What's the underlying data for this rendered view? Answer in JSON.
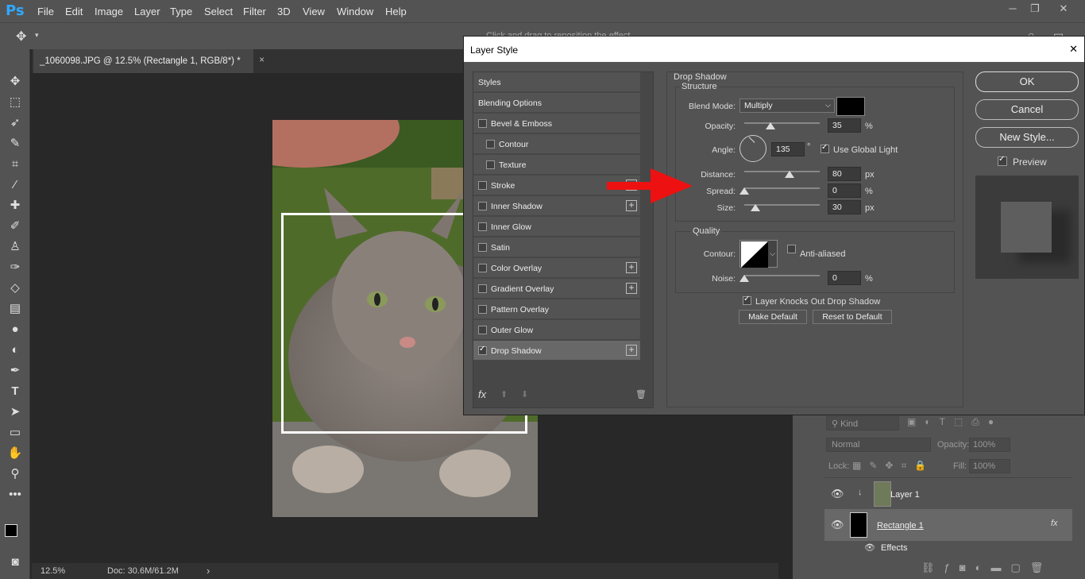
{
  "app": {
    "logo": "Ps"
  },
  "menubar": {
    "items": [
      "File",
      "Edit",
      "Image",
      "Layer",
      "Type",
      "Select",
      "Filter",
      "3D",
      "View",
      "Window",
      "Help"
    ]
  },
  "options": {
    "hint": "Click and drag to reposition the effect."
  },
  "document": {
    "tab_title": "_1060098.JPG @ 12.5% (Rectangle 1, RGB/8*) *",
    "close": "×"
  },
  "status": {
    "zoom": "12.5%",
    "doc": "Doc: 30.6M/61.2M",
    "arrow": "›"
  },
  "dialog": {
    "title": "Layer Style",
    "close": "✕",
    "styles_header": "Styles",
    "blending_options": "Blending Options",
    "items": [
      {
        "label": "Bevel & Emboss",
        "checked": false,
        "plus": false
      },
      {
        "label": "Contour",
        "checked": false,
        "plus": false,
        "indent": true
      },
      {
        "label": "Texture",
        "checked": false,
        "plus": false,
        "indent": true
      },
      {
        "label": "Stroke",
        "checked": false,
        "plus": true
      },
      {
        "label": "Inner Shadow",
        "checked": false,
        "plus": true
      },
      {
        "label": "Inner Glow",
        "checked": false,
        "plus": false
      },
      {
        "label": "Satin",
        "checked": false,
        "plus": false
      },
      {
        "label": "Color Overlay",
        "checked": false,
        "plus": true
      },
      {
        "label": "Gradient Overlay",
        "checked": false,
        "plus": true
      },
      {
        "label": "Pattern Overlay",
        "checked": false,
        "plus": false
      },
      {
        "label": "Outer Glow",
        "checked": false,
        "plus": false
      },
      {
        "label": "Drop Shadow",
        "checked": true,
        "plus": true,
        "active": true
      }
    ],
    "fx": "fx",
    "drop_shadow": {
      "section": "Drop Shadow",
      "structure": "Structure",
      "blend_mode_label": "Blend Mode:",
      "blend_mode": "Multiply",
      "shadow_color": "#000000",
      "opacity_label": "Opacity:",
      "opacity": "35",
      "opacity_fraction": 0.35,
      "angle_label": "Angle:",
      "angle": "135",
      "degree": "°",
      "use_global_light": "Use Global Light",
      "use_global_light_checked": true,
      "distance_label": "Distance:",
      "distance": "80",
      "distance_fraction": 0.6,
      "spread_label": "Spread:",
      "spread": "0",
      "spread_fraction": 0,
      "size_label": "Size:",
      "size": "30",
      "size_fraction": 0.15,
      "unit_pct": "%",
      "unit_px": "px",
      "quality": "Quality",
      "contour_label": "Contour:",
      "anti_aliased": "Anti-aliased",
      "noise_label": "Noise:",
      "noise": "0",
      "knocks_out": "Layer Knocks Out Drop Shadow",
      "make_default": "Make Default",
      "reset_default": "Reset to Default"
    },
    "buttons": {
      "ok": "OK",
      "cancel": "Cancel",
      "new_style": "New Style...",
      "preview": "Preview"
    }
  },
  "layers": {
    "kind": "Kind",
    "blend": "Normal",
    "opacity_label": "Opacity:",
    "opacity": "100%",
    "lock_label": "Lock:",
    "fill_label": "Fill:",
    "fill": "100%",
    "items": [
      {
        "name": "Layer 1"
      },
      {
        "name": "Rectangle 1",
        "fx": "fx"
      }
    ],
    "effects": "Effects"
  }
}
